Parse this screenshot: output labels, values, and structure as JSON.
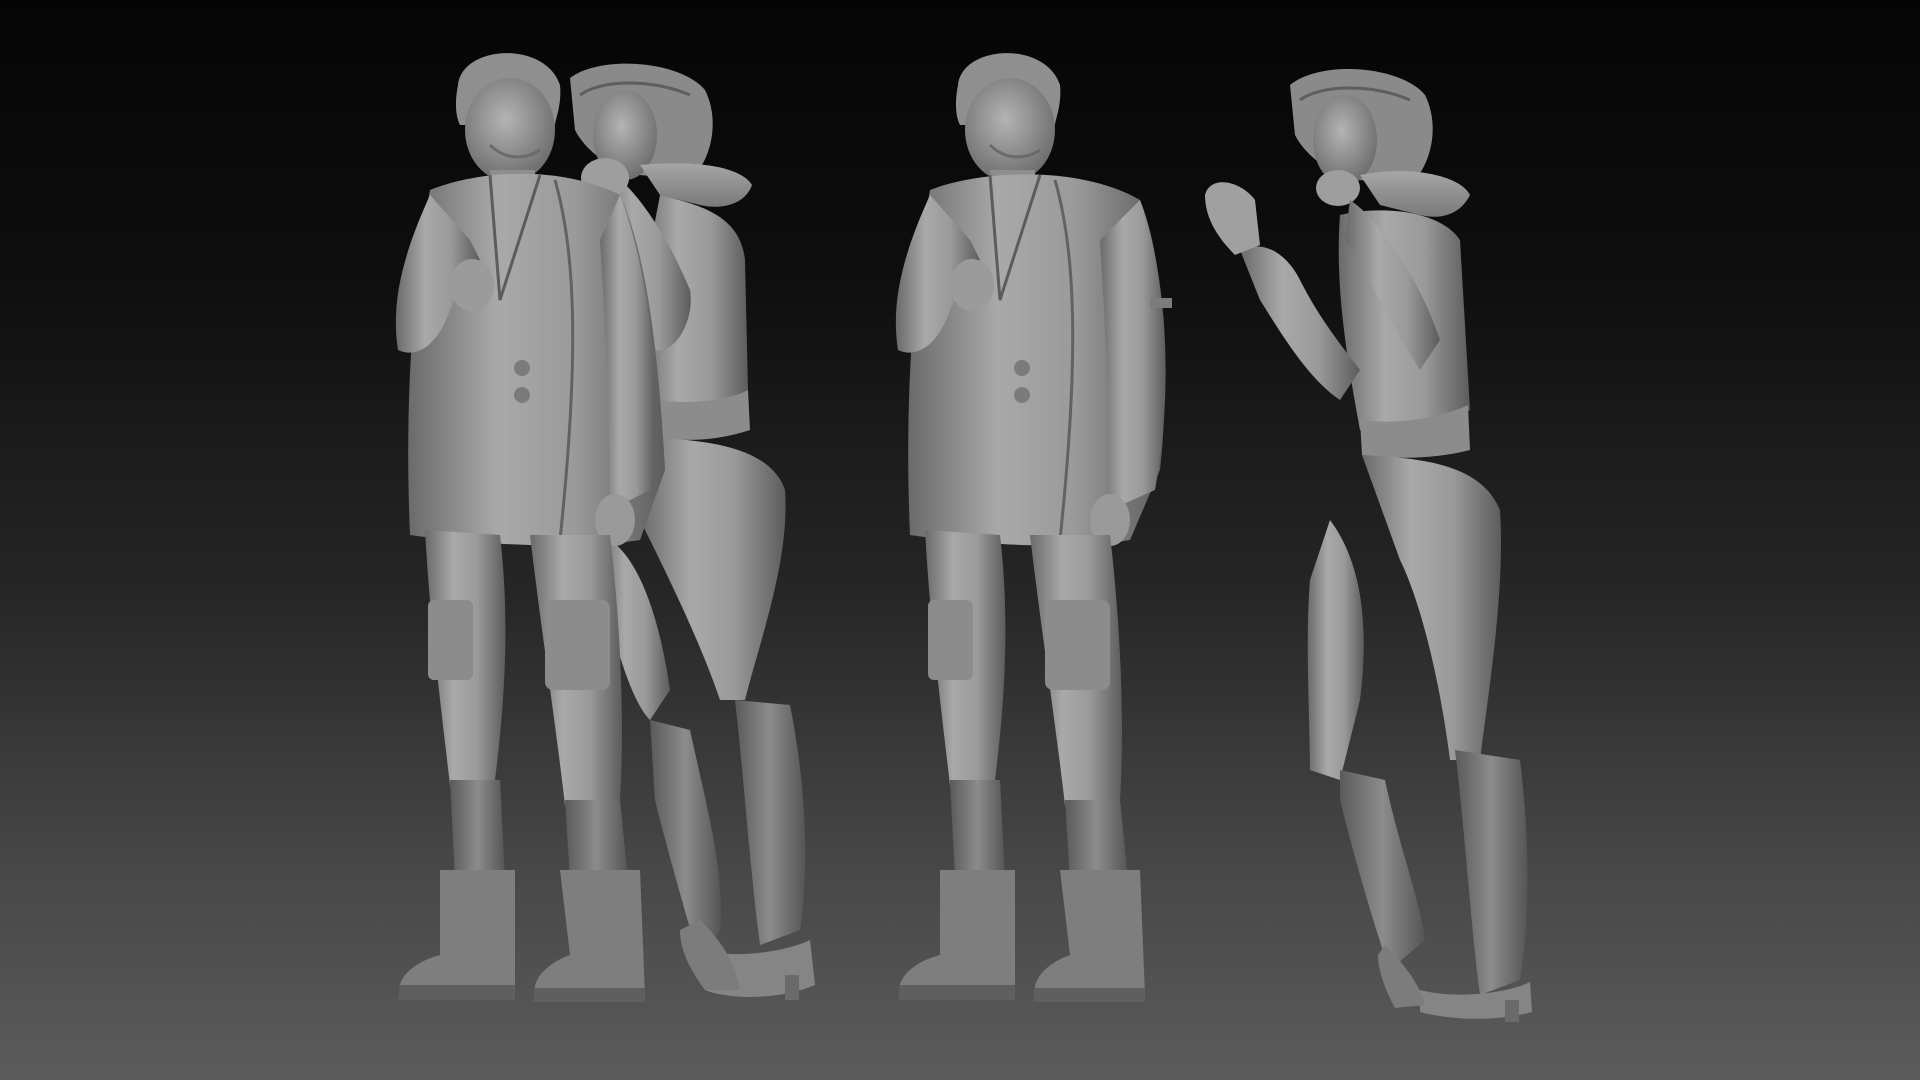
{
  "scene": {
    "kind": "3D sculpt render",
    "groups": [
      {
        "name": "couple-pose",
        "figures": [
          "man-in-beanie-and-blazer",
          "woman-in-puffer-jacket-leaning"
        ]
      },
      {
        "name": "separated-pose",
        "figures": [
          "man-in-beanie-and-blazer",
          "woman-in-puffer-jacket-waving"
        ]
      }
    ],
    "palette": {
      "background_top": "#050505",
      "background_bottom": "#5b5b5b",
      "clay_light": "#b0b0b0",
      "clay_mid": "#8e8e8e",
      "clay_dark": "#5a5a5a"
    }
  }
}
